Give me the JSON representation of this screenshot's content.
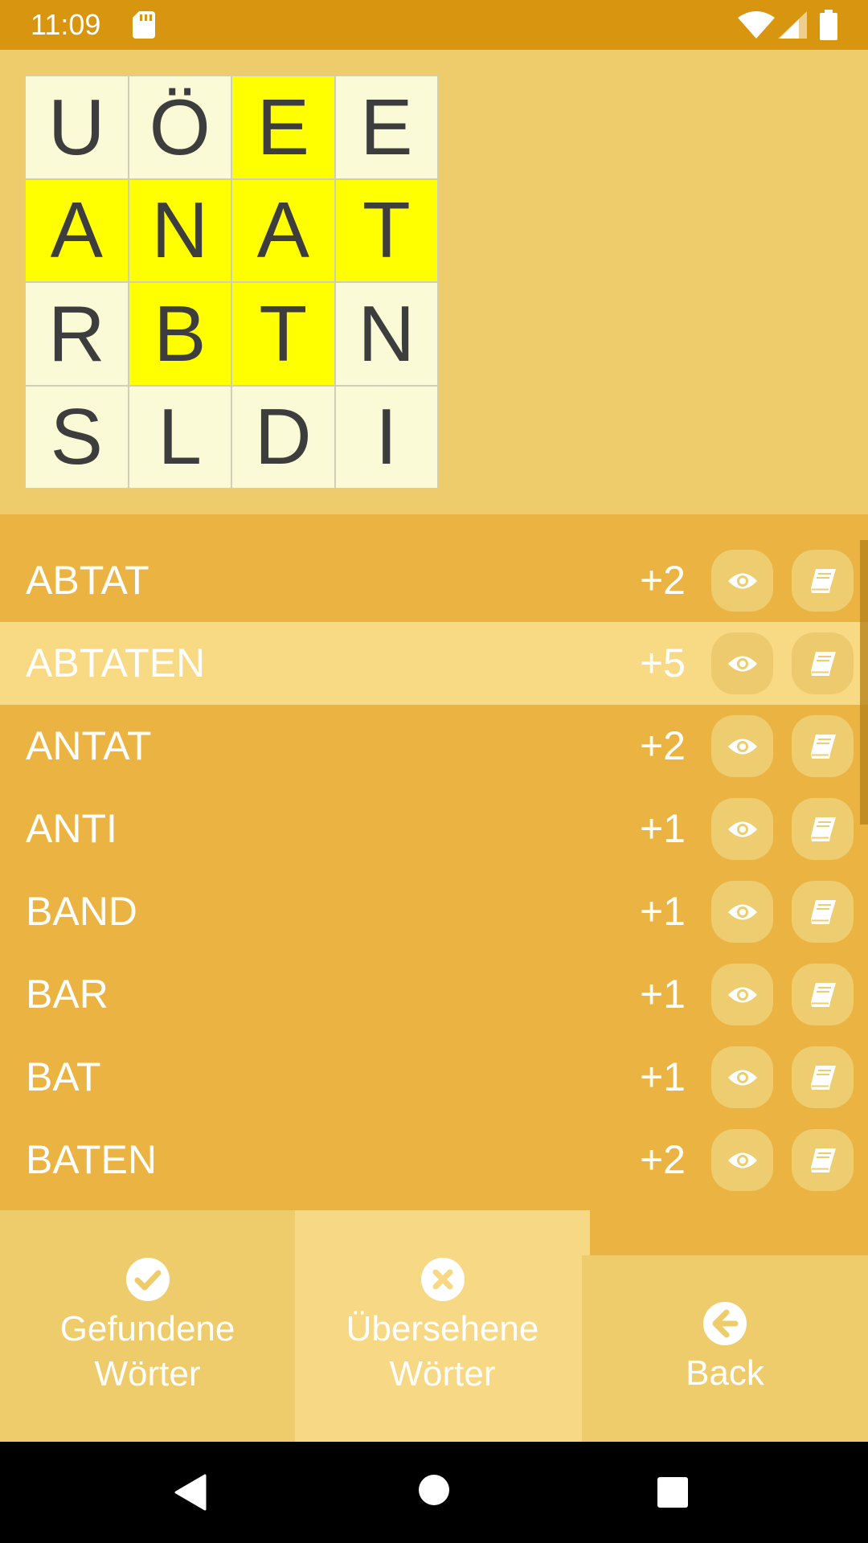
{
  "status": {
    "time": "11:09"
  },
  "board": {
    "cells": [
      {
        "letter": "U",
        "highlight": false
      },
      {
        "letter": "Ö",
        "highlight": false
      },
      {
        "letter": "E",
        "highlight": true
      },
      {
        "letter": "E",
        "highlight": false
      },
      {
        "letter": "A",
        "highlight": true
      },
      {
        "letter": "N",
        "highlight": true
      },
      {
        "letter": "A",
        "highlight": true
      },
      {
        "letter": "T",
        "highlight": true
      },
      {
        "letter": "R",
        "highlight": false
      },
      {
        "letter": "B",
        "highlight": true
      },
      {
        "letter": "T",
        "highlight": true
      },
      {
        "letter": "N",
        "highlight": false
      },
      {
        "letter": "S",
        "highlight": false
      },
      {
        "letter": "L",
        "highlight": false
      },
      {
        "letter": "D",
        "highlight": false
      },
      {
        "letter": "I",
        "highlight": false
      }
    ]
  },
  "words": [
    {
      "word": "ABTAT",
      "points": "+2",
      "selected": false
    },
    {
      "word": "ABTATEN",
      "points": "+5",
      "selected": true
    },
    {
      "word": "ANTAT",
      "points": "+2",
      "selected": false
    },
    {
      "word": "ANTI",
      "points": "+1",
      "selected": false
    },
    {
      "word": "BAND",
      "points": "+1",
      "selected": false
    },
    {
      "word": "BAR",
      "points": "+1",
      "selected": false
    },
    {
      "word": "BAT",
      "points": "+1",
      "selected": false
    },
    {
      "word": "BATEN",
      "points": "+2",
      "selected": false
    }
  ],
  "buttons": {
    "found_line1": "Gefundene",
    "found_line2": "Wörter",
    "missed_line1": "Übersehene",
    "missed_line2": "Wörter",
    "back": "Back"
  },
  "colors": {
    "status_bar": "#d8950f",
    "board_bg": "#eecc6c",
    "list_bg": "#ebb442",
    "cell": "#fafad7",
    "cell_highlight": "#ffff00",
    "selected_row": "#f8da85"
  }
}
